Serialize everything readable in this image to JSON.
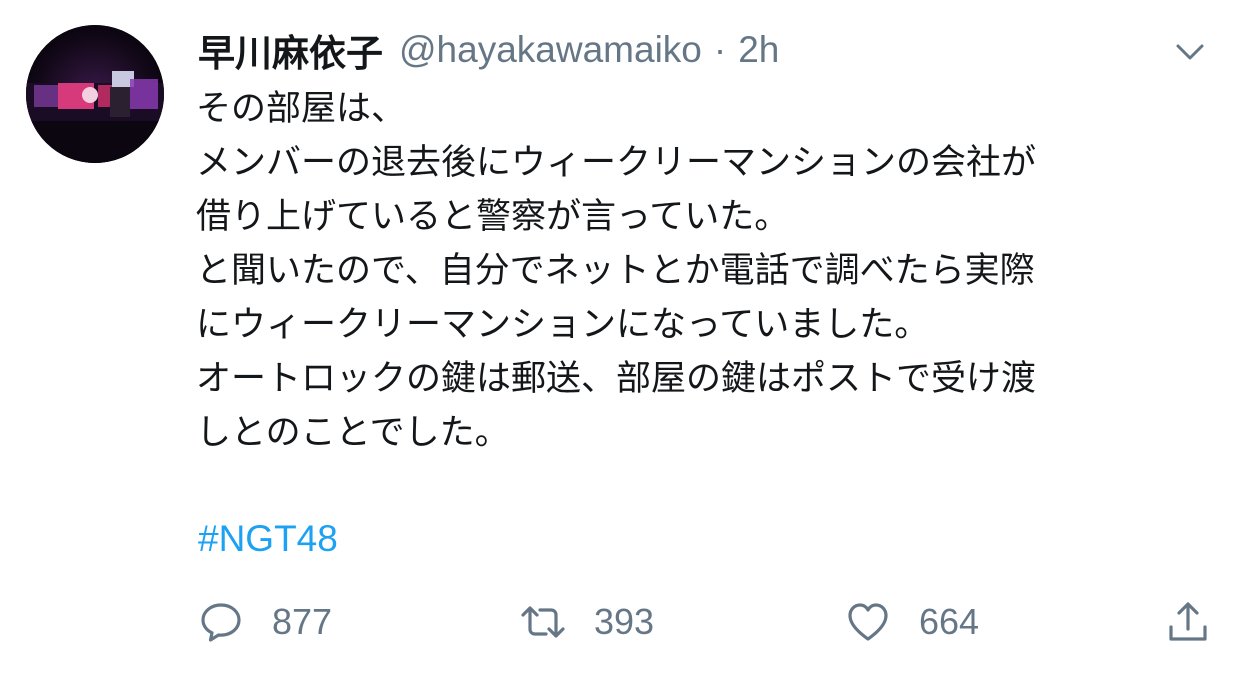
{
  "tweet": {
    "display_name": "早川麻依子",
    "handle": "@hayakawamaiko",
    "separator": "·",
    "time": "2h",
    "lines": [
      "その部屋は、",
      "メンバーの退去後にウィークリーマンションの会社が",
      "借り上げていると警察が言っていた。",
      "と聞いたので、自分でネットとか電話で調べたら実際",
      "にウィークリーマンションになっていました。",
      "オートロックの鍵は郵送、部屋の鍵はポストで受け渡",
      "しとのことでした。"
    ],
    "hashtag": "#NGT48",
    "replies": "877",
    "retweets": "393",
    "likes": "664"
  },
  "icons": {
    "menu": "chevron-down-icon",
    "reply": "reply-icon",
    "retweet": "retweet-icon",
    "like": "heart-icon",
    "share": "share-icon"
  },
  "colors": {
    "text": "#14171a",
    "secondary": "#657786",
    "link": "#1da1f2"
  }
}
